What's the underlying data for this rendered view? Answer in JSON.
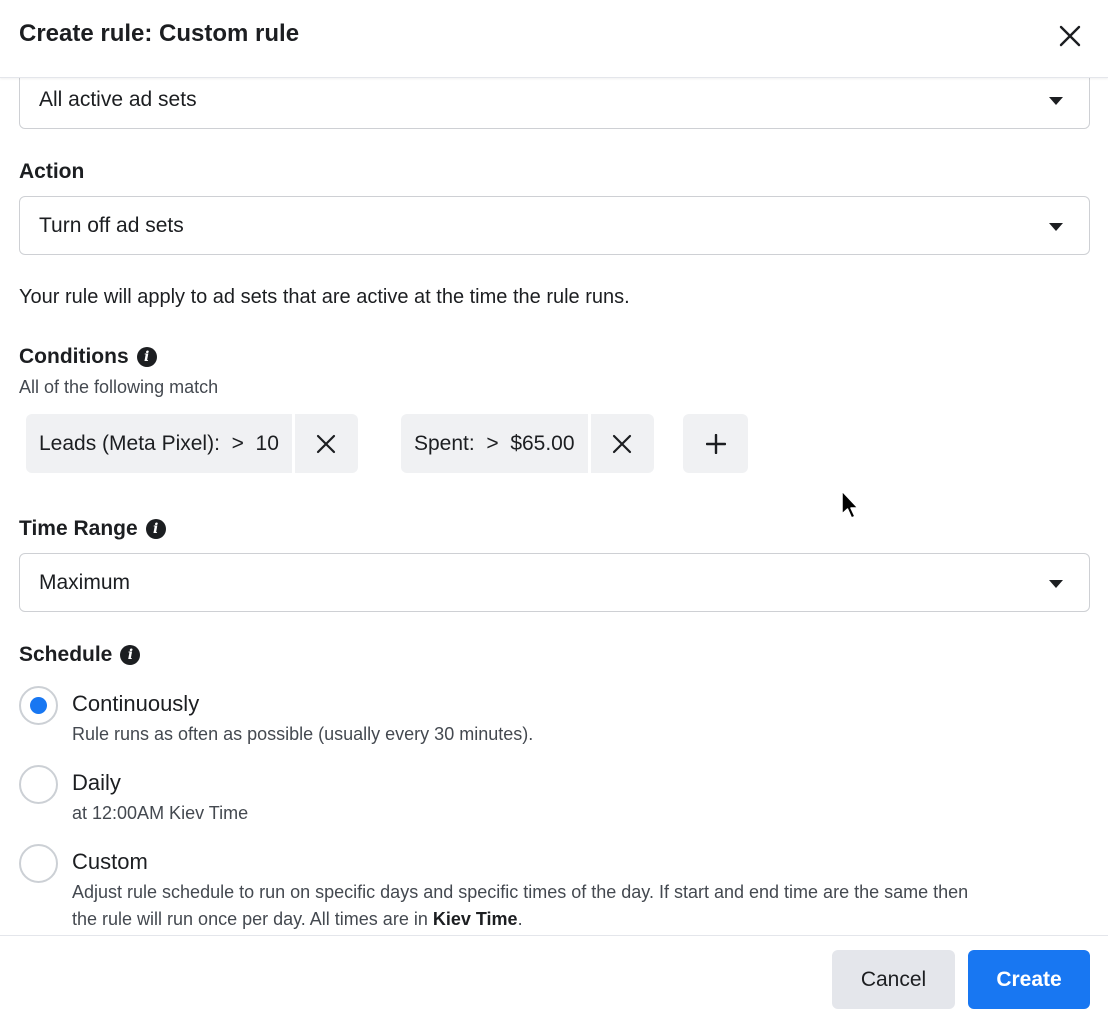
{
  "header": {
    "title": "Create rule: Custom rule"
  },
  "apply_to": {
    "value": "All active ad sets"
  },
  "action": {
    "label": "Action",
    "value": "Turn off ad sets"
  },
  "apply_note": "Your rule will apply to ad sets that are active at the time the rule runs.",
  "conditions": {
    "label": "Conditions",
    "subtitle": "All of the following match",
    "items": [
      {
        "text": "Leads (Meta Pixel):  >  10"
      },
      {
        "text": "Spent:  >  $65.00"
      }
    ]
  },
  "time_range": {
    "label": "Time Range",
    "value": "Maximum"
  },
  "schedule": {
    "label": "Schedule",
    "options": [
      {
        "title": "Continuously",
        "desc": "Rule runs as often as possible (usually every 30 minutes).",
        "checked": true
      },
      {
        "title": "Daily",
        "desc": "at 12:00AM Kiev Time",
        "checked": false
      },
      {
        "title": "Custom",
        "desc_line1": "Adjust rule schedule to run on specific days and specific times of the day. If start and end time are the same then",
        "desc_line2_prefix": "the rule will run once per day. All times are in ",
        "desc_line2_bold": "Kiev Time",
        "desc_line2_suffix": ".",
        "checked": false
      }
    ]
  },
  "footer": {
    "cancel_label": "Cancel",
    "create_label": "Create"
  },
  "colors": {
    "primary": "#1877f2",
    "chip_bg": "#f0f1f3"
  }
}
